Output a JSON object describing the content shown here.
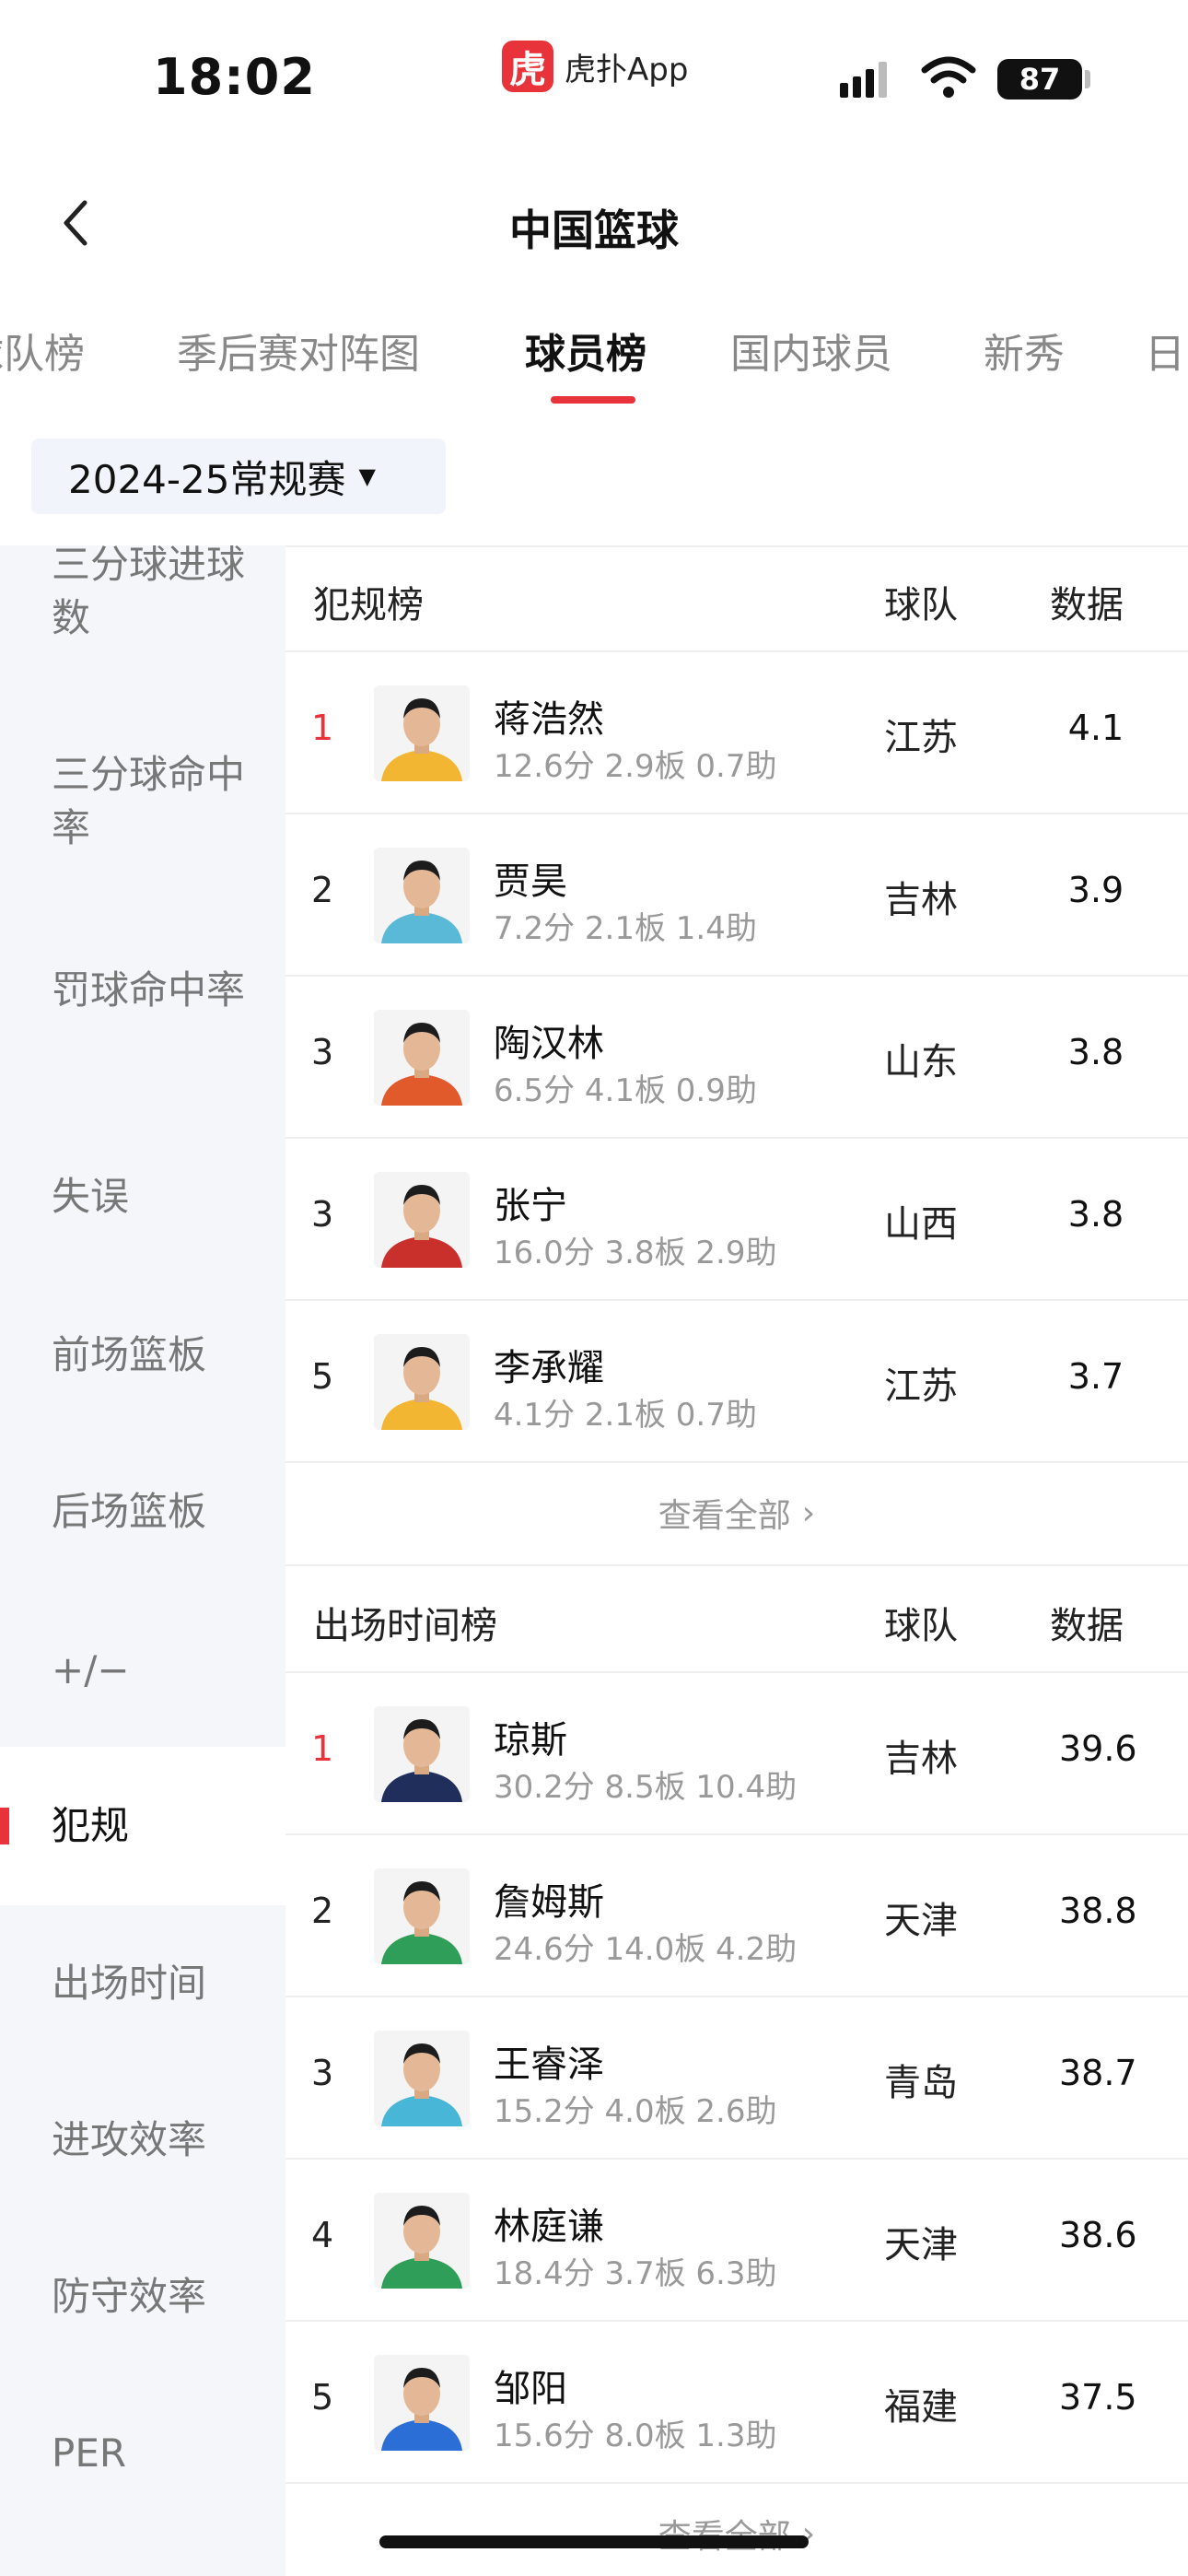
{
  "status_bar": {
    "time": "18:02",
    "app_logo_char": "虎",
    "app_name": "虎扑App",
    "battery": "87"
  },
  "header": {
    "title": "中国篮球"
  },
  "tabs": [
    {
      "label": "球队榜",
      "active": false
    },
    {
      "label": "季后赛对阵图",
      "active": false
    },
    {
      "label": "球员榜",
      "active": true
    },
    {
      "label": "国内球员",
      "active": false
    },
    {
      "label": "新秀",
      "active": false
    },
    {
      "label": "日",
      "active": false
    }
  ],
  "season_selector": {
    "value": "2024-25常规赛"
  },
  "sidebar": {
    "items": [
      {
        "label": "三分球进球数",
        "active": false
      },
      {
        "label": "三分球命中率",
        "active": false
      },
      {
        "label": "罚球命中率",
        "active": false
      },
      {
        "label": "失误",
        "active": false
      },
      {
        "label": "前场篮板",
        "active": false
      },
      {
        "label": "后场篮板",
        "active": false
      },
      {
        "label": "+/−",
        "active": false
      },
      {
        "label": "犯规",
        "active": true
      },
      {
        "label": "出场时间",
        "active": false
      },
      {
        "label": "进攻效率",
        "active": false
      },
      {
        "label": "防守效率",
        "active": false
      },
      {
        "label": "PER",
        "active": false
      }
    ]
  },
  "sections": [
    {
      "title": "犯规榜",
      "team_header": "球队",
      "data_header": "数据",
      "view_all": "查看全部",
      "rows": [
        {
          "rank": "1",
          "name": "蒋浩然",
          "stats": "12.6分 2.9板 0.7助",
          "team": "江苏",
          "value": "4.1",
          "jersey": "#f2b632"
        },
        {
          "rank": "2",
          "name": "贾昊",
          "stats": "7.2分 2.1板 1.4助",
          "team": "吉林",
          "value": "3.9",
          "jersey": "#5bb9d8"
        },
        {
          "rank": "3",
          "name": "陶汉林",
          "stats": "6.5分 4.1板 0.9助",
          "team": "山东",
          "value": "3.8",
          "jersey": "#e05a2b"
        },
        {
          "rank": "3",
          "name": "张宁",
          "stats": "16.0分 3.8板 2.9助",
          "team": "山西",
          "value": "3.8",
          "jersey": "#c9302c"
        },
        {
          "rank": "5",
          "name": "李承耀",
          "stats": "4.1分 2.1板 0.7助",
          "team": "江苏",
          "value": "3.7",
          "jersey": "#f2b632"
        }
      ]
    },
    {
      "title": "出场时间榜",
      "team_header": "球队",
      "data_header": "数据",
      "view_all": "查看全部",
      "rows": [
        {
          "rank": "1",
          "name": "琼斯",
          "stats": "30.2分 8.5板 10.4助",
          "team": "吉林",
          "value": "39.6",
          "jersey": "#1f2e5a"
        },
        {
          "rank": "2",
          "name": "詹姆斯",
          "stats": "24.6分 14.0板 4.2助",
          "team": "天津",
          "value": "38.8",
          "jersey": "#2f9e58"
        },
        {
          "rank": "3",
          "name": "王睿泽",
          "stats": "15.2分 4.0板 2.6助",
          "team": "青岛",
          "value": "38.7",
          "jersey": "#48b6d6"
        },
        {
          "rank": "4",
          "name": "林庭谦",
          "stats": "18.4分 3.7板 6.3助",
          "team": "天津",
          "value": "38.6",
          "jersey": "#2f9e58"
        },
        {
          "rank": "5",
          "name": "邹阳",
          "stats": "15.6分 8.0板 1.3助",
          "team": "福建",
          "value": "37.5",
          "jersey": "#2b6fd6"
        }
      ]
    }
  ]
}
